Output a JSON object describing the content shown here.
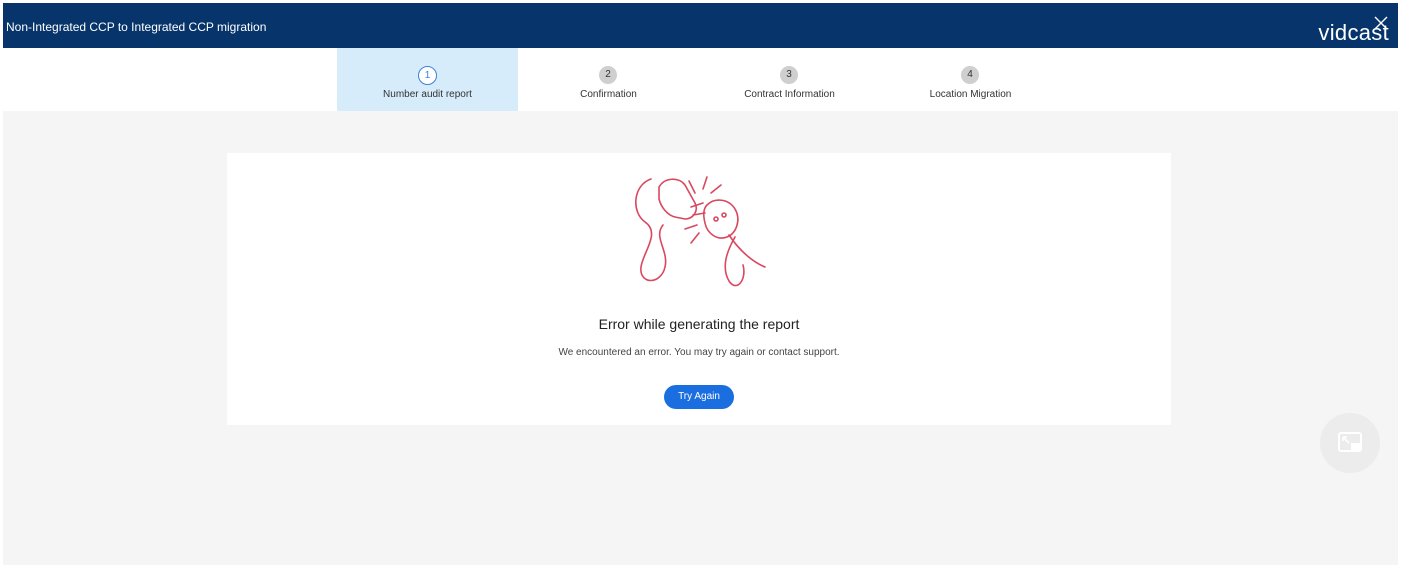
{
  "header": {
    "title": "Non-Integrated CCP to Integrated CCP migration",
    "brand": "vidcast",
    "close_icon": "close-icon"
  },
  "steps": [
    {
      "number": "1",
      "label": "Number audit report",
      "active": true
    },
    {
      "number": "2",
      "label": "Confirmation",
      "active": false
    },
    {
      "number": "3",
      "label": "Contract Information",
      "active": false
    },
    {
      "number": "4",
      "label": "Location Migration",
      "active": false
    }
  ],
  "error": {
    "title": "Error while generating the report",
    "message": "We encountered an error. You may try again or contact support.",
    "button_label": "Try Again",
    "illustration": "unplugged-cable-icon"
  },
  "pip": {
    "icon": "picture-in-picture-icon"
  },
  "colors": {
    "header_bg": "#07356b",
    "active_step_bg": "#d6ecfb",
    "button_bg": "#1a6ee0",
    "illustration": "#d9485f"
  }
}
